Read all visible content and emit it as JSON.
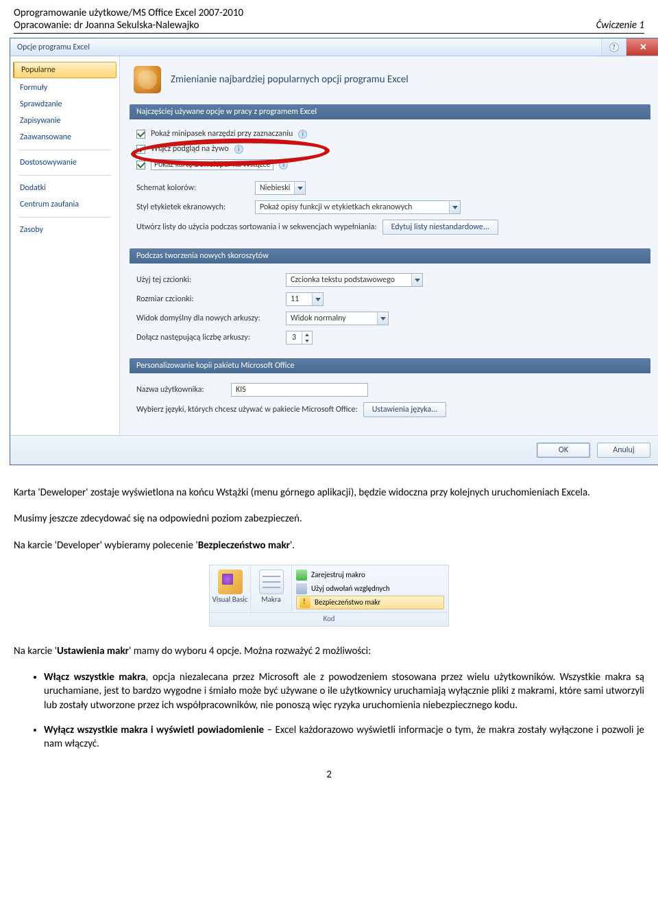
{
  "header": {
    "line1": "Oprogramowanie użytkowe/MS Office Excel 2007-2010",
    "line2": "Opracowanie: dr Joanna Sekulska-Nalewajko",
    "right": "Ćwiczenie 1"
  },
  "dialog": {
    "title": "Opcje programu Excel",
    "sidebar": [
      "Popularne",
      "Formuły",
      "Sprawdzanie",
      "Zapisywanie",
      "Zaawansowane",
      "Dostosowywanie",
      "Dodatki",
      "Centrum zaufania",
      "Zasoby"
    ],
    "sidebar_active": "Popularne",
    "main_title": "Zmienianie najbardziej popularnych opcji programu Excel",
    "section1": {
      "header": "Najczęściej używane opcje w pracy z programem Excel",
      "chk1": "Pokaż minipasek narzędzi przy zaznaczaniu",
      "chk2": "Włącz podgląd na żywo",
      "chk3": "Pokaż kartę Deweloper na Wstążce",
      "row_colors_label": "Schemat kolorów:",
      "row_colors_value": "Niebieski",
      "row_tips_label": "Styl etykietek ekranowych:",
      "row_tips_value": "Pokaż opisy funkcji w etykietkach ekranowych",
      "row_lists_label": "Utwórz listy do użycia podczas sortowania i w sekwencjach wypełniania:",
      "row_lists_btn": "Edytuj listy niestandardowe..."
    },
    "section2": {
      "header": "Podczas tworzenia nowych skoroszytów",
      "font_label": "Użyj tej czcionki:",
      "font_value": "Czcionka tekstu podstawowego",
      "size_label": "Rozmiar czcionki:",
      "size_value": "11",
      "view_label": "Widok domyślny dla nowych arkuszy:",
      "view_value": "Widok normalny",
      "sheets_label": "Dołącz następującą liczbę arkuszy:",
      "sheets_value": "3"
    },
    "section3": {
      "header": "Personalizowanie kopii pakietu Microsoft Office",
      "user_label": "Nazwa użytkownika:",
      "user_value": "KIS",
      "lang_label": "Wybierz języki, których chcesz używać w pakiecie Microsoft Office:",
      "lang_btn": "Ustawienia języka..."
    },
    "footer": {
      "ok": "OK",
      "cancel": "Anuluj"
    }
  },
  "body": {
    "p1a": "Karta 'Deweloper' zostaje wyświetlona na końcu Wstążki (menu górnego aplikacji), będzie widoczna przy kolejnych uruchomieniach Excela.",
    "p2a": "Musimy jeszcze zdecydować się na odpowiedni poziom zabezpieczeń.",
    "p3a": "Na karcie 'Developer' wybieramy polecenie '",
    "p3b": "Bezpieczeństwo makr",
    "p3c": "'.",
    "p4a": "Na karcie '",
    "p4b": "Ustawienia makr",
    "p4c": "' mamy do wyboru 4 opcje. Można rozważyć 2 możliwości:",
    "li1a": "Włącz wszystkie makra",
    "li1b": ", opcja niezalecana przez Microsoft ale z powodzeniem stosowana przez wielu użytkowników. Wszystkie makra są uruchamiane, jest to bardzo wygodne i śmiało może być używane o ile użytkownicy uruchamiają wyłącznie pliki z makrami, które sami utworzyli lub zostały utworzone przez ich współpracowników, nie ponoszą więc ryzyka uruchomienia niebezpiecznego kodu.",
    "li2a": "Wyłącz wszystkie makra i wyświetl powiadomienie",
    "li2b": " – Excel każdorazowo wyświetli informacje o tym, że makra zostały wyłączone i pozwoli je nam włączyć."
  },
  "ribbon": {
    "btn1": "Visual Basic",
    "btn2": "Makra",
    "item1": "Zarejestruj makro",
    "item2": "Użyj odwołań względnych",
    "item3": "Bezpieczeństwo makr",
    "group": "Kod"
  },
  "pagenum": "2"
}
